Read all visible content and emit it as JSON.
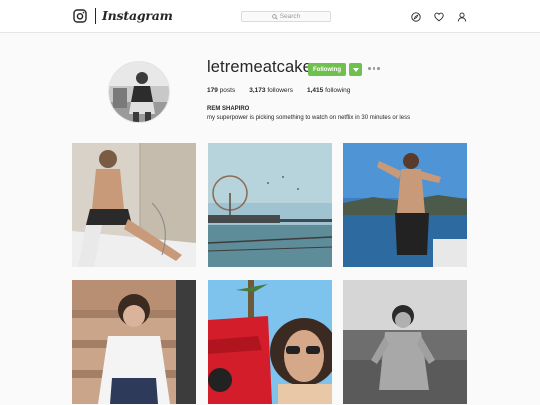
{
  "nav": {
    "brand": "Instagram",
    "search_placeholder": "Search",
    "icons": [
      "camera-logo-icon",
      "compass-icon",
      "heart-icon",
      "person-icon"
    ]
  },
  "profile": {
    "username": "letremeatcake",
    "follow_label": "Following",
    "stats": {
      "posts_count": "179",
      "posts_label": "posts",
      "followers_count": "3,173",
      "followers_label": "followers",
      "following_count": "1,415",
      "following_label": "following"
    },
    "full_name": "REM SHAPIRO",
    "bio": "my superpower is picking something to watch on netflix in 30 minutes or less"
  },
  "colors": {
    "accent_green": "#70c050",
    "border": "#e6e6e6",
    "background": "#fafafa"
  }
}
